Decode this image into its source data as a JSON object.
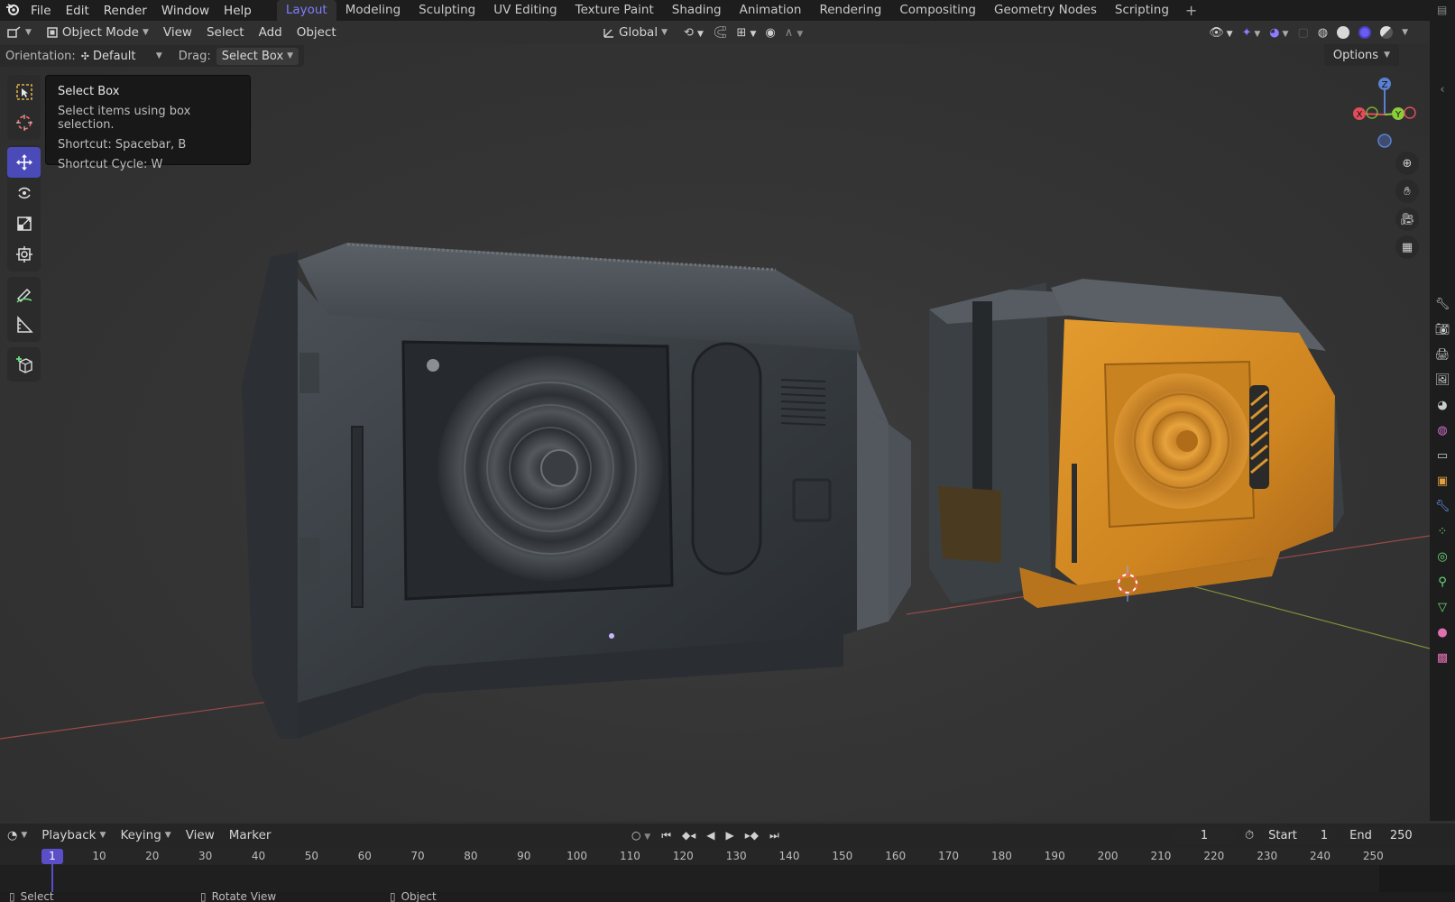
{
  "app": {
    "name": "Blender"
  },
  "menu": [
    "File",
    "Edit",
    "Render",
    "Window",
    "Help"
  ],
  "workspaces": {
    "active": "Layout",
    "tabs": [
      "Layout",
      "Modeling",
      "Sculpting",
      "UV Editing",
      "Texture Paint",
      "Shading",
      "Animation",
      "Rendering",
      "Compositing",
      "Geometry Nodes",
      "Scripting"
    ],
    "add_label": "+"
  },
  "viewport_header": {
    "mode": "Object Mode",
    "menus": [
      "View",
      "Select",
      "Add",
      "Object"
    ],
    "transform_orientation": "Global"
  },
  "tool_settings": {
    "orientation_label": "Orientation:",
    "orientation_value": "Default",
    "drag_label": "Drag:",
    "drag_value": "Select Box",
    "options_label": "Options"
  },
  "tooltip": {
    "title": "Select Box",
    "description": "Select items using box selection.",
    "shortcut": "Shortcut: Spacebar, B",
    "shortcut_cycle": "Shortcut Cycle: W"
  },
  "toolbar": {
    "active_tool": "move",
    "tools": [
      "select-box",
      "cursor",
      "move",
      "rotate",
      "scale",
      "transform",
      "annotate",
      "measure",
      "add-cube"
    ]
  },
  "gizmo": {
    "axes": [
      "X",
      "Y",
      "Z"
    ]
  },
  "colors": {
    "accent": "#5a4fc8",
    "active_tab_text": "#7d7dff",
    "x_axis": "#e04d5a",
    "y_axis": "#8ccc3a",
    "z_axis": "#5a80d0",
    "orange_model": "#d38a22",
    "dark_model": "#3d4248"
  },
  "timeline": {
    "menus": [
      "Playback",
      "Keying",
      "View",
      "Marker"
    ],
    "current_frame": "1",
    "start_label": "Start",
    "start_value": "1",
    "end_label": "End",
    "end_value": "250",
    "ruler": [
      "1",
      "10",
      "20",
      "30",
      "40",
      "50",
      "60",
      "70",
      "80",
      "90",
      "100",
      "110",
      "120",
      "130",
      "140",
      "150",
      "160",
      "170",
      "180",
      "190",
      "200",
      "210",
      "220",
      "230",
      "240",
      "250"
    ]
  },
  "statusbar": {
    "items": [
      "Select",
      "Rotate View",
      "Object"
    ]
  }
}
